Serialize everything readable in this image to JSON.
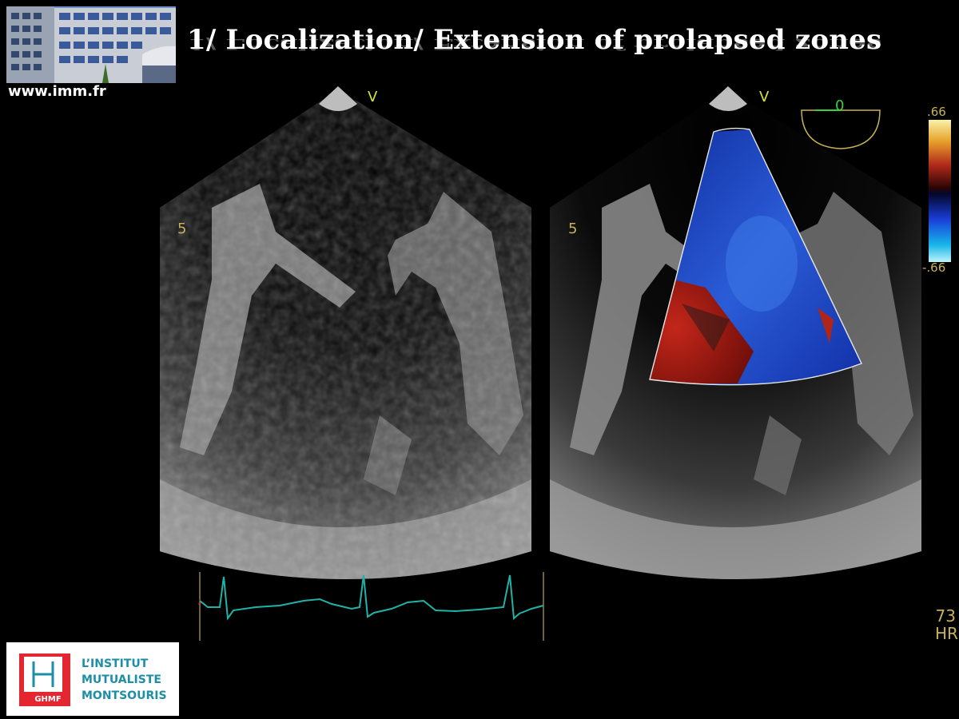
{
  "slide": {
    "title": "1/ Localization/ Extension of prolapsed zones",
    "website": "www.imm.fr"
  },
  "echo": {
    "left_marker_v": "V",
    "left_depth_mark": "5",
    "right_marker_v": "V",
    "right_depth_mark": "5",
    "angle_value": "0",
    "scale_max": ".66",
    "scale_min": "-.66",
    "hr_value": "73",
    "hr_label": "HR"
  },
  "logo": {
    "badge": "GHMF",
    "line1": "L’INSTITUT",
    "line2": "MUTUALISTE",
    "line3": "MONTSOURIS"
  },
  "colors": {
    "background": "#000000",
    "ecg_trace": "#1fb3a8",
    "marker_yellow": "#d7e33a",
    "doppler_blue": "#1636b8",
    "doppler_red": "#b31b12",
    "logo_teal": "#1c8fa6",
    "logo_red": "#e3262f"
  }
}
